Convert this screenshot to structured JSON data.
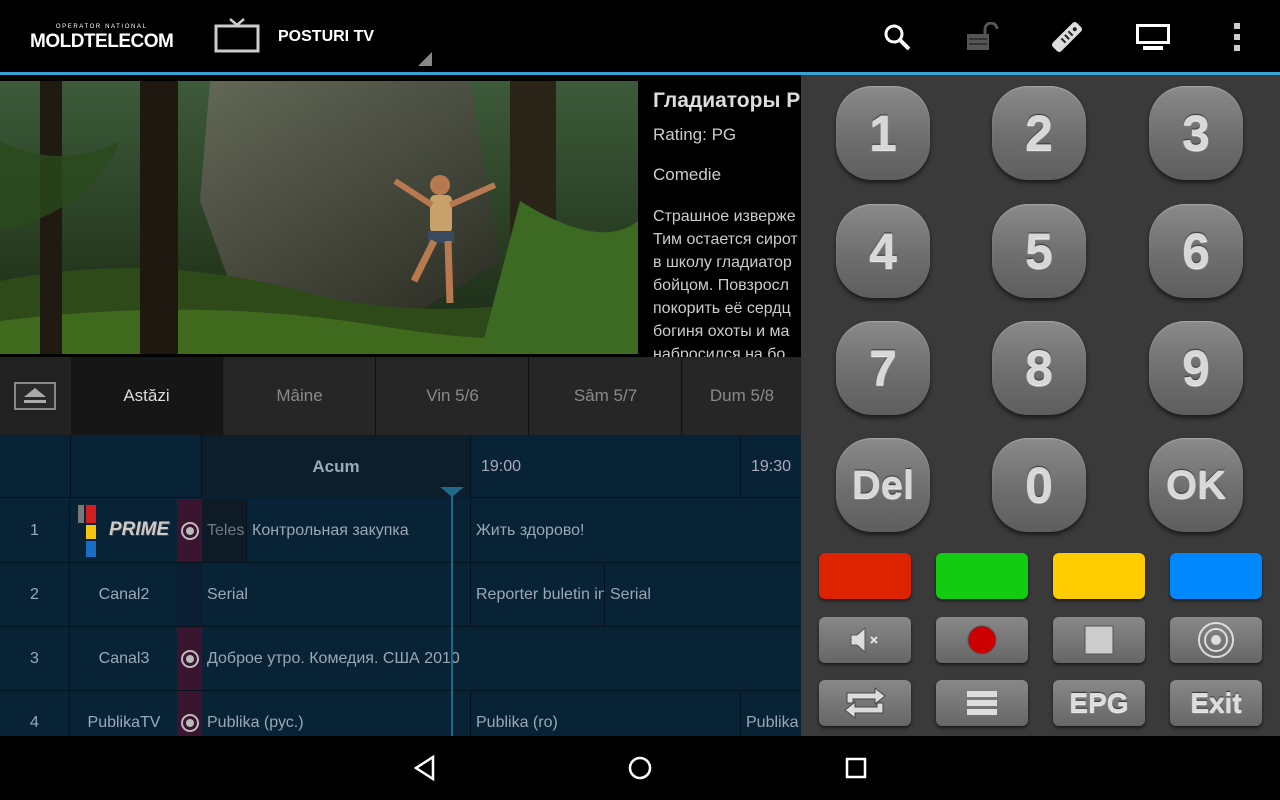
{
  "app": {
    "logo_small": "OPERATOR NATIONAL",
    "logo_big": "MOLDTELECOM",
    "title": "POSTURI TV"
  },
  "actions": [
    "search-icon",
    "unlock-icon",
    "remote-icon",
    "screen-icon",
    "overflow-menu-icon"
  ],
  "program": {
    "title": "Гладиаторы Р",
    "rating": "Rating: PG",
    "genre": "Comedie",
    "description": "Страшное изверже\nТим остается сирот\nв школу гладиатор\nбойцом. Повзросл\nпокорить её сердц\nбогиня охоты и ма\nнабросился на бо"
  },
  "days": {
    "tabs": [
      "Astăzi",
      "Mâine",
      "Vin 5/6",
      "Sâm 5/7",
      "Dum 5/8"
    ],
    "active_index": 0
  },
  "epg": {
    "now_label": "Acum",
    "times": [
      "19:00",
      "19:30"
    ],
    "rows": [
      {
        "num": "1",
        "channel": "PRIME",
        "logo": true,
        "rec": true,
        "programs": [
          "Teles",
          "Контрольная закупка",
          "Жить здорово!"
        ]
      },
      {
        "num": "2",
        "channel": "Canal2",
        "logo": false,
        "rec": false,
        "programs": [
          "Serial",
          "Reporter buletin in",
          "Serial"
        ]
      },
      {
        "num": "3",
        "channel": "Canal3",
        "logo": false,
        "rec": true,
        "programs": [
          "Доброе утро. Комедия. США 2010"
        ]
      },
      {
        "num": "4",
        "channel": "PublikaTV",
        "logo": false,
        "rec": true,
        "programs": [
          "Publika (рус.)",
          "Publika (ro)",
          "Publika"
        ]
      }
    ]
  },
  "remote": {
    "keys": [
      "1",
      "2",
      "3",
      "4",
      "5",
      "6",
      "7",
      "8",
      "9",
      "Del",
      "0",
      "OK"
    ],
    "colors": [
      "#dd2200",
      "#11cc11",
      "#ffcc00",
      "#0088ff"
    ],
    "func_icons": [
      "mute-icon",
      "record-icon",
      "stop-icon",
      "broadcast-icon",
      "swap-icon",
      "menu-icon"
    ],
    "epg_label": "EPG",
    "exit_label": "Exit"
  },
  "accent": "#3aa3d6"
}
